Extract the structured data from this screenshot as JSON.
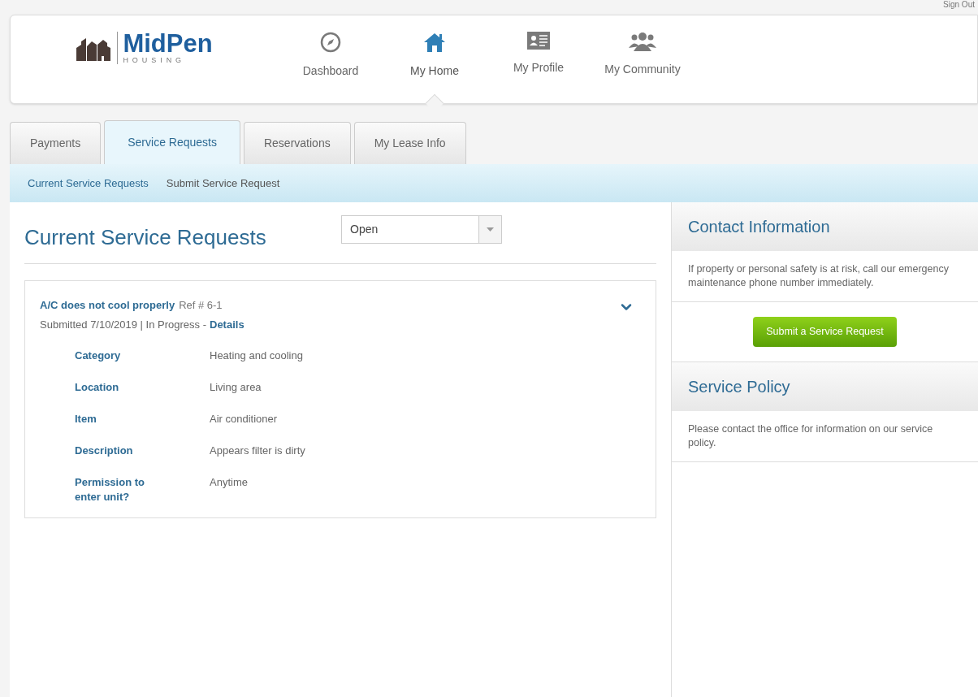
{
  "top_link": "Sign Out",
  "logo": {
    "name": "MidPen",
    "tagline": "HOUSING"
  },
  "nav": [
    {
      "label": "Dashboard",
      "kind": "compass",
      "selected": false
    },
    {
      "label": "My Home",
      "kind": "home",
      "selected": true
    },
    {
      "label": "My Profile",
      "kind": "profile",
      "selected": false
    },
    {
      "label": "My Community",
      "kind": "community",
      "selected": false
    }
  ],
  "tabs": [
    {
      "label": "Payments",
      "selected": false
    },
    {
      "label": "Service Requests",
      "selected": true
    },
    {
      "label": "Reservations",
      "selected": false
    },
    {
      "label": "My Lease Info",
      "selected": false
    }
  ],
  "subnav": [
    {
      "label": "Current Service Requests",
      "selected": true
    },
    {
      "label": "Submit Service Request",
      "selected": false
    }
  ],
  "main": {
    "title": "Current Service Requests",
    "filter": "Open",
    "request": {
      "title": "A/C does not cool properly",
      "ref": "Ref # 6-1",
      "status": "Submitted 7/10/2019 | In Progress -",
      "details_link": "Details",
      "expanded": true,
      "fields": [
        {
          "label": "Category",
          "value": "Heating and cooling"
        },
        {
          "label": "Location",
          "value": "Living area"
        },
        {
          "label": "Item",
          "value": "Air conditioner"
        },
        {
          "label": "Description",
          "value": "Appears filter is dirty"
        },
        {
          "label": "Permission to enter unit?",
          "value": "Anytime"
        }
      ]
    }
  },
  "sidebar": {
    "contact": {
      "title": "Contact Information",
      "text": "If property or personal safety is at risk, call our emergency maintenance phone number immediately.",
      "button": "Submit a Service Request"
    },
    "policy": {
      "title": "Service Policy",
      "text": "Please contact the office for information on our service policy."
    }
  }
}
